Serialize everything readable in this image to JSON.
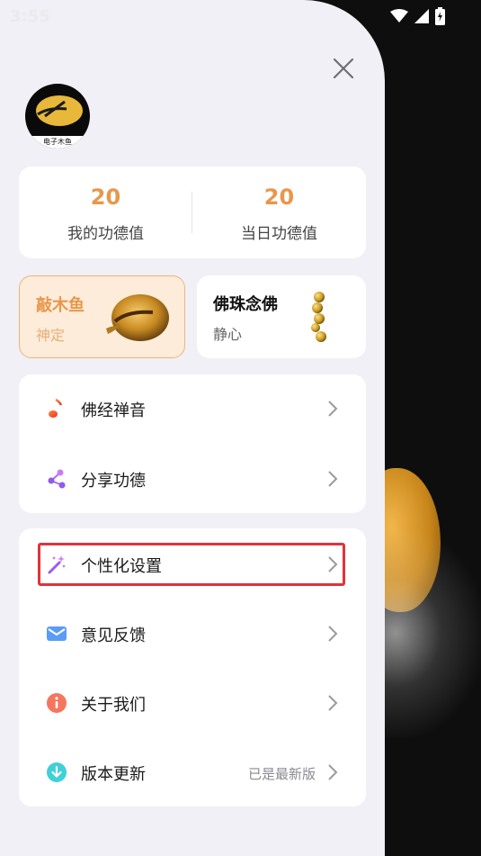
{
  "status_bar": {
    "time": "3:55"
  },
  "avatar": {
    "caption": "电子木鱼"
  },
  "stats": [
    {
      "value": "20",
      "label": "我的功德值"
    },
    {
      "value": "20",
      "label": "当日功德值"
    }
  ],
  "modes": [
    {
      "title": "敲木鱼",
      "subtitle": "神定"
    },
    {
      "title": "佛珠念佛",
      "subtitle": "静心"
    }
  ],
  "menu_group_1": [
    {
      "label": "佛经禅音",
      "icon": "music-note-icon"
    },
    {
      "label": "分享功德",
      "icon": "share-icon"
    }
  ],
  "menu_group_2": [
    {
      "label": "个性化设置",
      "icon": "magic-wand-icon"
    },
    {
      "label": "意见反馈",
      "icon": "mail-icon"
    },
    {
      "label": "关于我们",
      "icon": "info-icon"
    },
    {
      "label": "版本更新",
      "icon": "download-icon",
      "extra": "已是最新版"
    }
  ],
  "colors": {
    "accent": "#e8974a",
    "highlight": "#e2323a",
    "drawer_bg": "#f1f0f6"
  }
}
